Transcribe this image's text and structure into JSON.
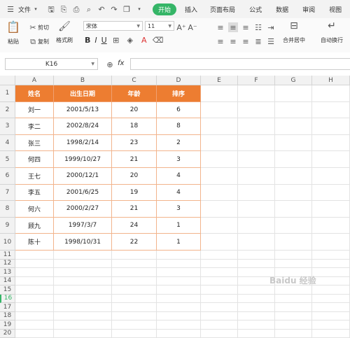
{
  "menu": {
    "file": "文件",
    "tabs": [
      "开始",
      "插入",
      "页面布局",
      "公式",
      "数据",
      "审阅",
      "视图"
    ]
  },
  "ribbon": {
    "paste": "粘贴",
    "cut": "剪切",
    "copy": "复制",
    "format_painter": "格式刷",
    "font_name": "宋体",
    "font_size": "11",
    "bold": "B",
    "italic": "I",
    "underline": "U",
    "merge": "合并居中",
    "wrap": "自动换行"
  },
  "formula_bar": {
    "name_box": "K16",
    "fx": "fx"
  },
  "columns": [
    "A",
    "B",
    "C",
    "D",
    "E",
    "F",
    "G",
    "H"
  ],
  "rows": [
    "1",
    "2",
    "3",
    "4",
    "5",
    "6",
    "7",
    "8",
    "9",
    "10",
    "11",
    "12",
    "13",
    "14",
    "15",
    "16",
    "17",
    "18",
    "19",
    "20"
  ],
  "table": {
    "headers": [
      "姓名",
      "出生日期",
      "年龄",
      "排序"
    ],
    "rows": [
      [
        "刘一",
        "2001/5/13",
        "20",
        "6"
      ],
      [
        "李二",
        "2002/8/24",
        "18",
        "8"
      ],
      [
        "张三",
        "1998/2/14",
        "23",
        "2"
      ],
      [
        "何四",
        "1999/10/27",
        "21",
        "3"
      ],
      [
        "王七",
        "2000/12/1",
        "20",
        "4"
      ],
      [
        "李五",
        "2001/6/25",
        "19",
        "4"
      ],
      [
        "何六",
        "2000/2/27",
        "21",
        "3"
      ],
      [
        "顾九",
        "1997/3/7",
        "24",
        "1"
      ],
      [
        "陈十",
        "1998/10/31",
        "22",
        "1"
      ]
    ]
  },
  "watermark": "Baidu 经验",
  "accent": "#ed7d31"
}
